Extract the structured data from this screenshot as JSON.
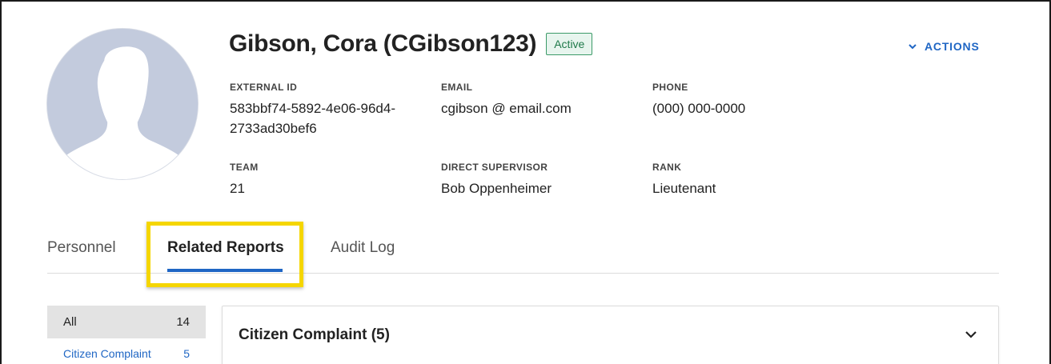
{
  "profile": {
    "name": "Gibson, Cora (CGibson123)",
    "status": "Active",
    "actions_label": "ACTIONS"
  },
  "fields": {
    "external_id": {
      "label": "EXTERNAL ID",
      "value": "583bbf74-5892-4e06-96d4-2733ad30bef6"
    },
    "email": {
      "label": "EMAIL",
      "value": "cgibson @ email.com"
    },
    "phone": {
      "label": "PHONE",
      "value": "(000) 000-0000"
    },
    "team": {
      "label": "TEAM",
      "value": "21"
    },
    "supervisor": {
      "label": "DIRECT SUPERVISOR",
      "value": "Bob Oppenheimer"
    },
    "rank": {
      "label": "RANK",
      "value": "Lieutenant"
    }
  },
  "tabs": [
    {
      "label": "Personnel"
    },
    {
      "label": "Related Reports",
      "active": true
    },
    {
      "label": "Audit Log"
    }
  ],
  "sidebar": {
    "items": [
      {
        "label": "All",
        "count": "14",
        "selected": true
      },
      {
        "label": "Citizen Complaint",
        "count": "5"
      }
    ]
  },
  "panel": {
    "title": "Citizen Complaint (5)"
  },
  "colors": {
    "accent": "#1f66c4",
    "highlight": "#f5d600",
    "status_green": "#1f7a4a",
    "avatar_bg": "#c3cbdd"
  },
  "icons": {
    "actions": "chevron-down-icon",
    "panel_toggle": "chevron-down-icon",
    "avatar": "person-silhouette-icon"
  }
}
